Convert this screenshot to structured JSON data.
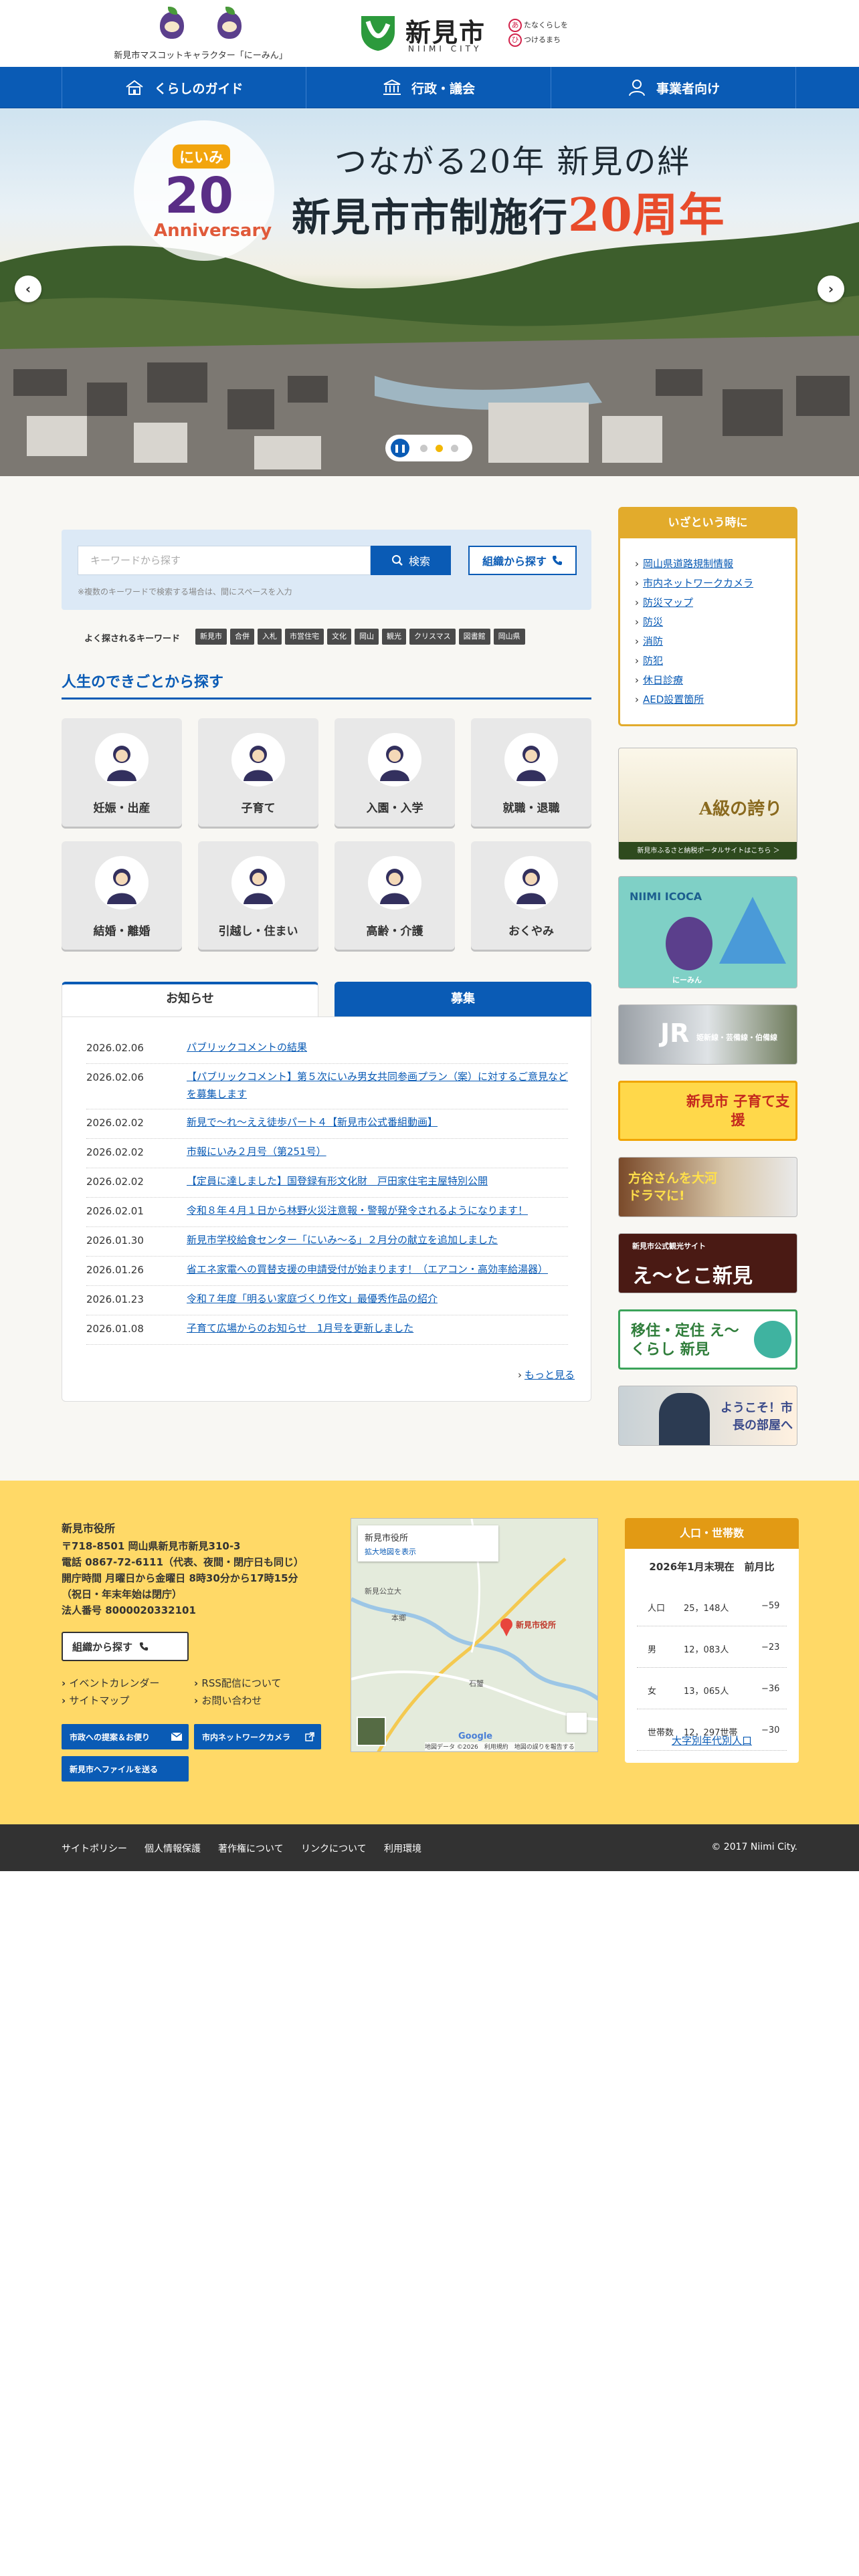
{
  "header": {
    "mascot_caption": "新見市マスコットキャラクター「にーみん」",
    "city_name": "新見市",
    "city_name_en": "NIIMI CITY",
    "tagline_mark1": "あ",
    "tagline_text1": "たなくらしを",
    "tagline_mark2": "ひ",
    "tagline_text2": "つけるまち"
  },
  "nav": {
    "items": [
      {
        "label": "くらしのガイド"
      },
      {
        "label": "行政・議会"
      },
      {
        "label": "事業者向け"
      }
    ]
  },
  "hero": {
    "title_line1": "つながる20年 新見の絆",
    "title_line2_prefix": "新見市市制施行",
    "title_line2_highlight": "20周年",
    "badge_top": "にいみ",
    "badge_number": "20",
    "badge_bottom": "Anniversary",
    "prev_arrow": "‹",
    "next_arrow": "›",
    "pause_symbol": "❚❚",
    "current_slide": 2,
    "slide_count": 3
  },
  "search": {
    "placeholder": "キーワードから探す",
    "search_button": "検索",
    "org_button": "組織から探す",
    "note": "※複数のキーワードで検索する場合は、間にスペースを入力"
  },
  "keywords": {
    "label": "よく探されるキーワード",
    "items": [
      "新見市",
      "合併",
      "入札",
      "市営住宅",
      "文化",
      "岡山",
      "観光",
      "クリスマス",
      "図書館",
      "岡山県"
    ]
  },
  "life": {
    "title": "人生のできごとから探す",
    "items": [
      {
        "label": "妊娠・出産"
      },
      {
        "label": "子育て"
      },
      {
        "label": "入園・入学"
      },
      {
        "label": "就職・退職"
      },
      {
        "label": "結婚・離婚"
      },
      {
        "label": "引越し・住まい"
      },
      {
        "label": "高齢・介護"
      },
      {
        "label": "おくやみ"
      }
    ]
  },
  "news": {
    "tab_news": "お知らせ",
    "tab_recruit": "募集",
    "items": [
      {
        "date": "2026.02.06",
        "text": "パブリックコメントの結果"
      },
      {
        "date": "2026.02.06",
        "text": "【パブリックコメント】第５次にいみ男女共同参画プラン（案）に対するご意見などを募集します"
      },
      {
        "date": "2026.02.02",
        "text": "新見で〜れ〜ええ徒歩パート４【新見市公式番組動画】"
      },
      {
        "date": "2026.02.02",
        "text": "市報にいみ２月号（第251号）"
      },
      {
        "date": "2026.02.02",
        "text": "【定員に達しました】国登録有形文化財　戸田家住宅主屋特別公開"
      },
      {
        "date": "2026.02.01",
        "text": "令和８年４月１日から林野火災注意報・警報が発令されるようになります！"
      },
      {
        "date": "2026.01.30",
        "text": "新見市学校給食センター「にいみ〜る」２月分の献立を追加しました"
      },
      {
        "date": "2026.01.26",
        "text": "省エネ家電への買替支援の申請受付が始まります！（エアコン・高効率給湯器）"
      },
      {
        "date": "2026.01.23",
        "text": "令和７年度「明るい家庭づくり作文」最優秀作品の紹介"
      },
      {
        "date": "2026.01.08",
        "text": "子育て広場からのお知らせ　1月号を更新しました"
      }
    ],
    "more": "もっと見る"
  },
  "emergency": {
    "title": "いざという時に",
    "items": [
      "岡山県道路規制情報",
      "市内ネットワークカメラ",
      "防災マップ",
      "防災",
      "消防",
      "防犯",
      "休日診療",
      "AED設置箇所"
    ]
  },
  "banners": [
    {
      "text_main": "A級の誇り",
      "text_sub": "新見市ふるさと納税ポータルサイトはこちら ＞"
    },
    {
      "text_main": "NIIMI ICOCA",
      "text_sub": "にーみん"
    },
    {
      "text_main": "JR",
      "text_sub": "姫新線・芸備線・伯備線"
    },
    {
      "text_main": "新見市 子育て支援",
      "text_sub": ""
    },
    {
      "text_main": "方谷さんを大河ドラマに!",
      "text_sub": ""
    },
    {
      "text_main": "え〜とこ新見",
      "text_sub": "新見市公式観光サイト"
    },
    {
      "text_main": "移住・定住 え〜くらし 新見",
      "text_sub": ""
    },
    {
      "text_main": "ようこそ！市長の部屋へ",
      "text_sub": ""
    }
  ],
  "footer": {
    "name": "新見市役所",
    "address_lines": [
      "〒718-8501 岡山県新見市新見310-3",
      "電話 0867-72-6111（代表、夜間・閉庁日も同じ）",
      "開庁時間 月曜日から金曜日 8時30分から17時15分",
      "（祝日・年末年始は閉庁）",
      "法人番号 8000020332101"
    ],
    "org_button": "組織から探す",
    "links": [
      "イベントカレンダー",
      "RSS配信について",
      "サイトマップ",
      "お問い合わせ"
    ],
    "blue_buttons": [
      "市政への提案＆お便り",
      "市内ネットワークカメラ",
      "新見市ヘファイルを送る"
    ],
    "map_title": "新見市役所",
    "map_link": "拡大地図を表示",
    "map_pin": "新見市役所",
    "map_place1": "新見公立大",
    "map_place2": "石蟹",
    "map_place3": "本郷",
    "map_credit": "Google",
    "map_footer": "地図データ ©2026　利用規約　地図の誤りを報告する"
  },
  "population": {
    "title": "人口・世帯数",
    "subtitle": "2026年1月末現在　前月比",
    "rows": [
      {
        "key": "人口",
        "value": "25，148人",
        "diff": "−59"
      },
      {
        "key": "男",
        "value": "12，083人",
        "diff": "−23"
      },
      {
        "key": "女",
        "value": "13，065人",
        "diff": "−36"
      },
      {
        "key": "世帯数",
        "value": "12，297世帯",
        "diff": "−30"
      }
    ],
    "link": "大字別年代別人口"
  },
  "bottom": {
    "links": [
      "サイトポリシー",
      "個人情報保護",
      "著作権について",
      "リンクについて",
      "利用環境"
    ],
    "copyright": "© 2017 Niimi City."
  },
  "colors": {
    "primary_blue": "#0a5bb5",
    "accent_yellow": "#ffd967",
    "emergency_gold": "#e2ab2c",
    "footer_dark": "#323232"
  }
}
